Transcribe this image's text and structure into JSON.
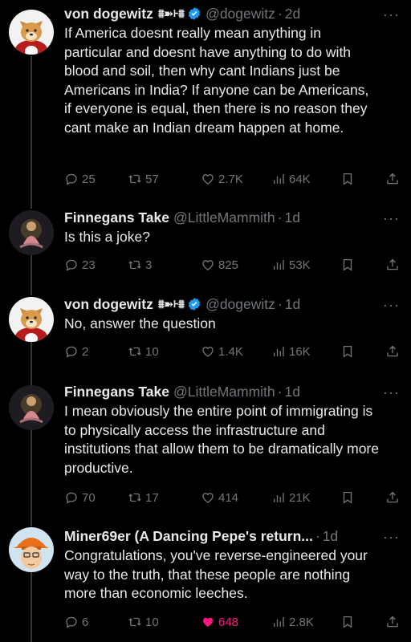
{
  "tweets": [
    {
      "name": "von dogewitz",
      "name_decor": "⩩➽⹐⩩",
      "verified": true,
      "handle": "@dogewitz",
      "time": "2d",
      "text": "If America doesnt really mean anything in particular and doesnt have anything to do with blood and soil, then why cant Indians just be Americans in India? If anyone can be Americans, if everyone is equal, then there is no reason they cant make an Indian dream happen at home.",
      "replies": "25",
      "reposts": "57",
      "likes": "2.7K",
      "views": "64K",
      "liked": false
    },
    {
      "name": "Finnegans Take",
      "name_decor": "",
      "verified": false,
      "handle": "@LittleMammith",
      "time": "1d",
      "text": "Is this a joke?",
      "replies": "23",
      "reposts": "3",
      "likes": "825",
      "views": "53K",
      "liked": false
    },
    {
      "name": "von dogewitz",
      "name_decor": "⩩➽⹐⩩",
      "verified": true,
      "handle": "@dogewitz",
      "time": "1d",
      "text": "No, answer the question",
      "replies": "2",
      "reposts": "10",
      "likes": "1.4K",
      "views": "16K",
      "liked": false
    },
    {
      "name": "Finnegans Take",
      "name_decor": "",
      "verified": false,
      "handle": "@LittleMammith",
      "time": "1d",
      "text": "I mean obviously the entire point of immigrating is to physically access the infrastructure and institutions that allow them to be dramatically more productive.",
      "replies": "70",
      "reposts": "17",
      "likes": "414",
      "views": "21K",
      "liked": false
    },
    {
      "name": "Miner69er (A Dancing Pepe's return...",
      "name_decor": "",
      "verified": false,
      "handle": "",
      "time": "1d",
      "text": "Congratulations, you've reverse-engineered your way to the truth, that these people are nothing more than economic leeches.",
      "replies": "6",
      "reposts": "10",
      "likes": "648",
      "views": "2.8K",
      "liked": true
    }
  ],
  "separator": "·",
  "more_glyph": "···",
  "colors": {
    "background": "#000000",
    "text": "#e7e9ea",
    "muted": "#71767b",
    "verified": "#1d9bf0",
    "like_active": "#f91880",
    "thread_line": "#333639"
  },
  "icons": [
    "reply-icon",
    "repost-icon",
    "heart-icon",
    "views-icon",
    "bookmark-icon",
    "share-icon",
    "verified-icon",
    "more-icon"
  ]
}
